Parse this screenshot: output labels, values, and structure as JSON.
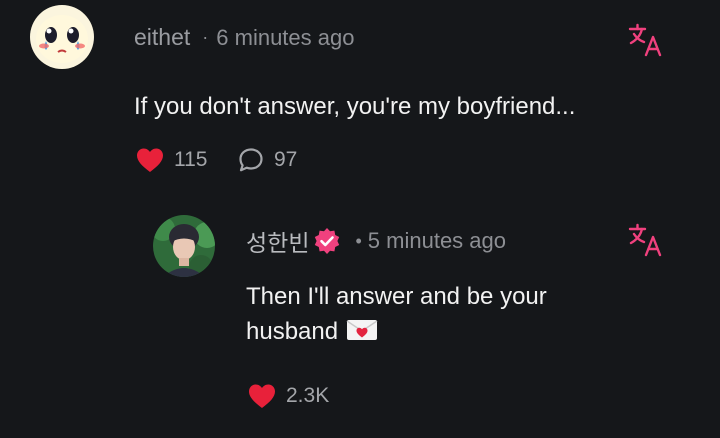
{
  "comment": {
    "username": "eithet",
    "separator": "·",
    "time": "6 minutes ago",
    "text": "If you don't answer, you're my boyfriend...",
    "likes": "115",
    "replies": "97",
    "avatar_icon": "emoji-face-avatar",
    "translate_icon": "translate-icon"
  },
  "reply": {
    "username": "성한빈",
    "separator": "•",
    "time": "5 minutes ago",
    "text_line1": "Then I'll answer and be your",
    "text_line2": "husband",
    "emoji": "love-letter-emoji",
    "likes": "2.3K",
    "verified_icon": "verified-badge-icon",
    "avatar_icon": "profile-photo-avatar",
    "translate_icon": "translate-icon"
  },
  "colors": {
    "background": "#15171a",
    "accent_pink": "#f0417e",
    "heart_red": "#e8213a",
    "muted_text": "#8d8f94"
  }
}
